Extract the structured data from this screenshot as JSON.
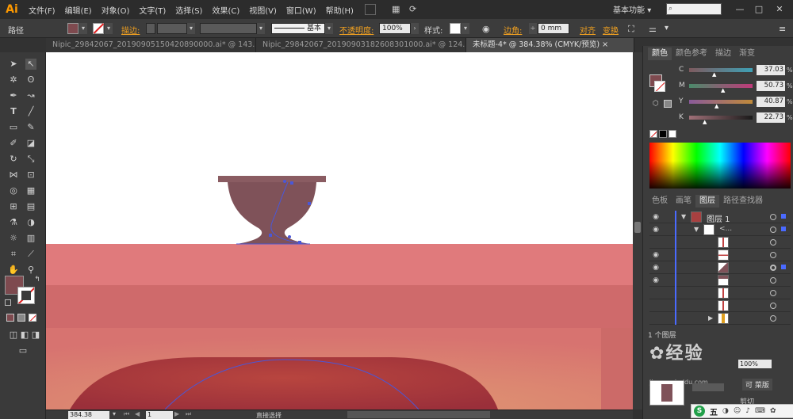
{
  "app": {
    "logo": "Ai",
    "menu": [
      "文件(F)",
      "编辑(E)",
      "对象(O)",
      "文字(T)",
      "选择(S)",
      "效果(C)",
      "视图(V)",
      "窗口(W)",
      "帮助(H)"
    ],
    "workspace": "基本功能",
    "workspace_arrow": "▾",
    "window_controls": [
      "—",
      "□",
      "✕"
    ]
  },
  "control_bar": {
    "selection_label": "路径",
    "stroke_label": "描边:",
    "stroke_profile": "基本",
    "opacity_label": "不透明度:",
    "opacity_value": "100%",
    "style_label": "样式:",
    "corner_label": "边角:",
    "corner_value": "0 mm",
    "align_label": "对齐",
    "transform_label": "变换"
  },
  "tabs": [
    {
      "label": "Nipic_29842067_20190905150420890000.ai* @ 143...",
      "active": false
    },
    {
      "label": "Nipic_29842067_20190903182608301000.ai* @ 124...",
      "active": false
    },
    {
      "label": "未标题-4* @ 384.38% (CMYK/预览)",
      "active": true
    }
  ],
  "tab_close": "×",
  "colors": {
    "fill": "#7e4a4f",
    "vase": "#7f5259",
    "vase_top": "#8a5c62",
    "table_top": "#e07a7c",
    "table_band": "#cf6a6b",
    "table_front": "#d77370",
    "sofa": "#a8383f",
    "selection": "#4a57d8"
  },
  "status": {
    "zoom": "384.38",
    "page": "1",
    "tool_name": "直接选择"
  },
  "color_panel": {
    "tabs": [
      "颜色",
      "颜色参考",
      "描边",
      "渐变"
    ],
    "sliders": [
      {
        "label": "C",
        "value": "37.03",
        "pos": 0.37
      },
      {
        "label": "M",
        "value": "50.73",
        "pos": 0.51
      },
      {
        "label": "Y",
        "value": "40.87",
        "pos": 0.41
      },
      {
        "label": "K",
        "value": "22.73",
        "pos": 0.23
      }
    ],
    "unit": "%"
  },
  "layers_panel": {
    "tabs": [
      "色板",
      "画笔",
      "图层",
      "路径查找器"
    ],
    "layer_name": "图层 1",
    "sublayer_name": "<...",
    "count_label": "1 个图层"
  },
  "watermark": {
    "text": "经验",
    "site": "jingyan.baidu.com"
  },
  "taskbar": {
    "ime": "五",
    "ime_logo": "S",
    "layer_label": "可 菜版",
    "bottom_label": "剪切"
  }
}
